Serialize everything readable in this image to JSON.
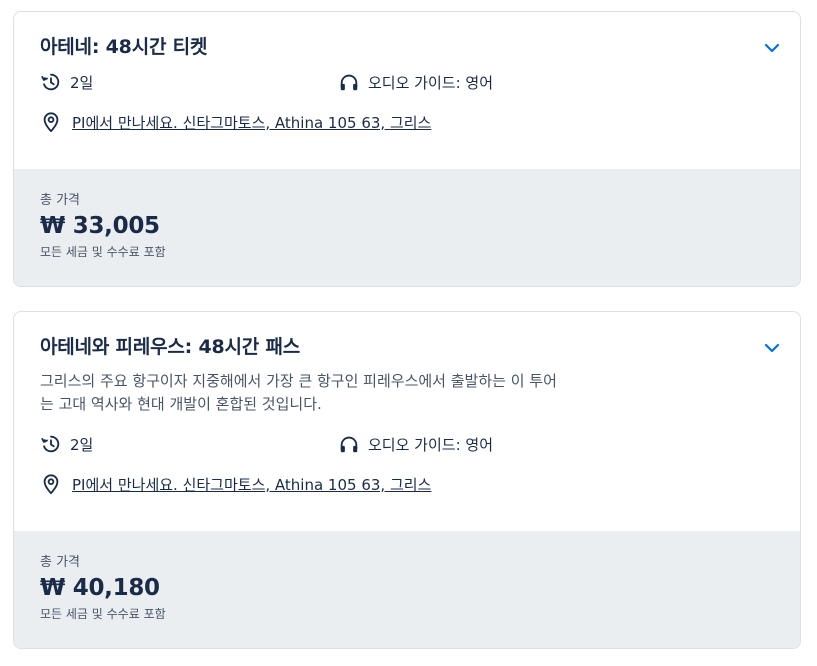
{
  "offers": [
    {
      "title": "아테네: 48시간 티켓",
      "description": "",
      "duration": "2일",
      "audio_guide": "오디오 가이드: 영어",
      "meeting_point": "PI에서 만나세요. 신타그마토스, Athina 105 63, 그리스",
      "total_label": "총 가격",
      "price": "₩ 33,005",
      "tax_note": "모든 세금 및 수수료 포함"
    },
    {
      "title": "아테네와 피레우스: 48시간 패스",
      "description": "그리스의 주요 항구이자 지중해에서 가장 큰 항구인 피레우스에서 출발하는 이 투어는 고대 역사와 현대 개발이 혼합된 것입니다.",
      "duration": "2일",
      "audio_guide": "오디오 가이드: 영어",
      "meeting_point": "PI에서 만나세요. 신타그마토스, Athina 105 63, 그리스",
      "total_label": "총 가격",
      "price": "₩ 40,180",
      "tax_note": "모든 세금 및 수수료 포함"
    }
  ],
  "icons": {
    "duration": "history-clock-icon",
    "audio": "headphones-icon",
    "location": "location-pin-icon",
    "expand": "chevron-down-icon"
  },
  "colors": {
    "text": "#1a2b49",
    "accent": "#0071eb",
    "price_panel": "#ebeef1",
    "border": "#dcdfe4"
  }
}
